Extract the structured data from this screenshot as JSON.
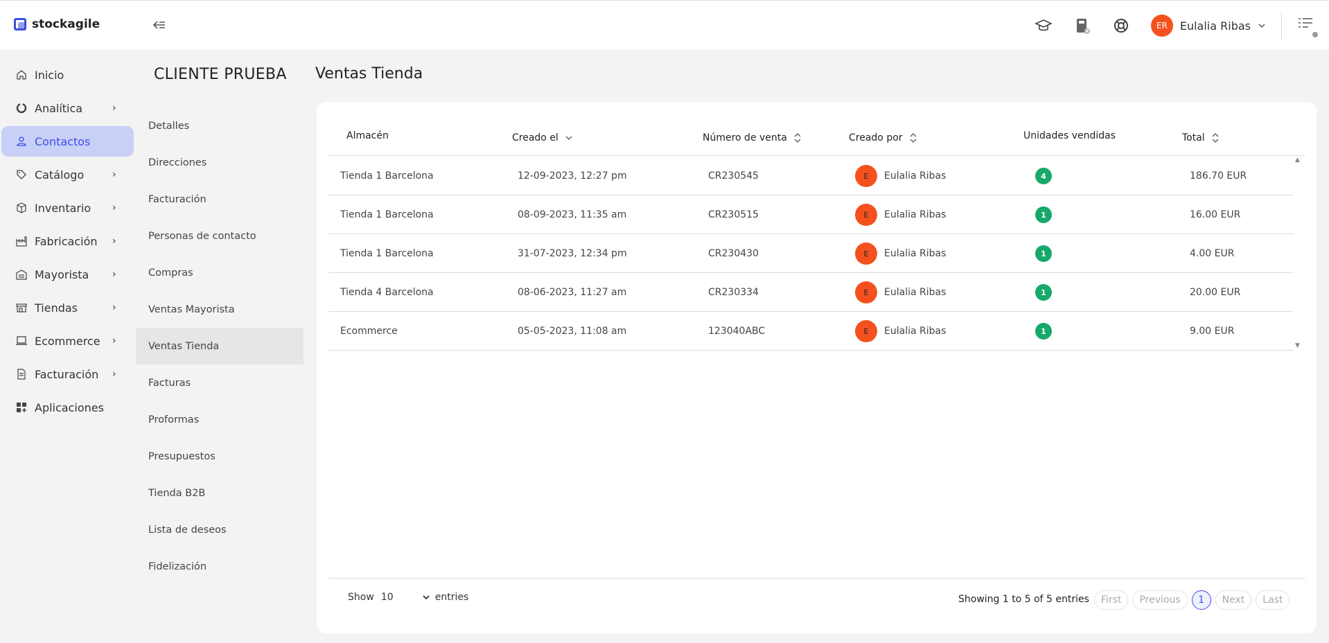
{
  "app": {
    "logo": "stockagile"
  },
  "header": {
    "user_initials": "ER",
    "user_name": "Eulalia Ribas"
  },
  "sidebar": {
    "items": [
      {
        "label": "Inicio",
        "icon": "home-icon"
      },
      {
        "label": "Analítica",
        "icon": "chart-icon"
      },
      {
        "label": "Contactos",
        "icon": "user-icon"
      },
      {
        "label": "Catálogo",
        "icon": "tag-icon"
      },
      {
        "label": "Inventario",
        "icon": "box-icon"
      },
      {
        "label": "Fabricación",
        "icon": "factory-icon"
      },
      {
        "label": "Mayorista",
        "icon": "warehouse-icon"
      },
      {
        "label": "Tiendas",
        "icon": "store-icon"
      },
      {
        "label": "Ecommerce",
        "icon": "laptop-icon"
      },
      {
        "label": "Facturación",
        "icon": "document-icon"
      },
      {
        "label": "Aplicaciones",
        "icon": "apps-icon"
      }
    ]
  },
  "subnav": {
    "title": "CLIENTE PRUEBA",
    "items": [
      "Detalles",
      "Direcciones",
      "Facturación",
      "Personas de contacto",
      "Compras",
      "Ventas Mayorista",
      "Ventas Tienda",
      "Facturas",
      "Proformas",
      "Presupuestos",
      "Tienda B2B",
      "Lista de deseos",
      "Fidelización"
    ]
  },
  "page": {
    "title": "Ventas Tienda"
  },
  "table": {
    "headers": [
      "Almacén",
      "Creado el",
      "Número de venta",
      "Creado por",
      "Unidades vendidas",
      "Total"
    ],
    "rows": [
      {
        "almacen": "Tienda 1 Barcelona",
        "fecha": "12-09-2023, 12:27 pm",
        "numero": "CR230545",
        "avatar": "E",
        "usuario": "Eulalia Ribas",
        "unidades": "4",
        "total": "186.70 EUR"
      },
      {
        "almacen": "Tienda 1 Barcelona",
        "fecha": "08-09-2023, 11:35 am",
        "numero": "CR230515",
        "avatar": "E",
        "usuario": "Eulalia Ribas",
        "unidades": "1",
        "total": "16.00 EUR"
      },
      {
        "almacen": "Tienda 1 Barcelona",
        "fecha": "31-07-2023, 12:34 pm",
        "numero": "CR230430",
        "avatar": "E",
        "usuario": "Eulalia Ribas",
        "unidades": "1",
        "total": "4.00 EUR"
      },
      {
        "almacen": "Tienda 4 Barcelona",
        "fecha": "08-06-2023, 11:27 am",
        "numero": "CR230334",
        "avatar": "E",
        "usuario": "Eulalia Ribas",
        "unidades": "1",
        "total": "20.00 EUR"
      },
      {
        "almacen": "Ecommerce",
        "fecha": "05-05-2023, 11:08 am",
        "numero": "123040ABC",
        "avatar": "E",
        "usuario": "Eulalia Ribas",
        "unidades": "1",
        "total": "9.00 EUR"
      }
    ]
  },
  "footer": {
    "show": "Show",
    "entries_value": "10",
    "entries": "entries",
    "showing": "Showing 1 to 5 of 5 entries",
    "first": "First",
    "previous": "Previous",
    "page": "1",
    "next": "Next",
    "last": "Last"
  },
  "colors": {
    "accent": "#3b4fe0",
    "active_bg": "#c9d0f8",
    "avatar": "#f4511e",
    "badge": "#17a86b"
  }
}
